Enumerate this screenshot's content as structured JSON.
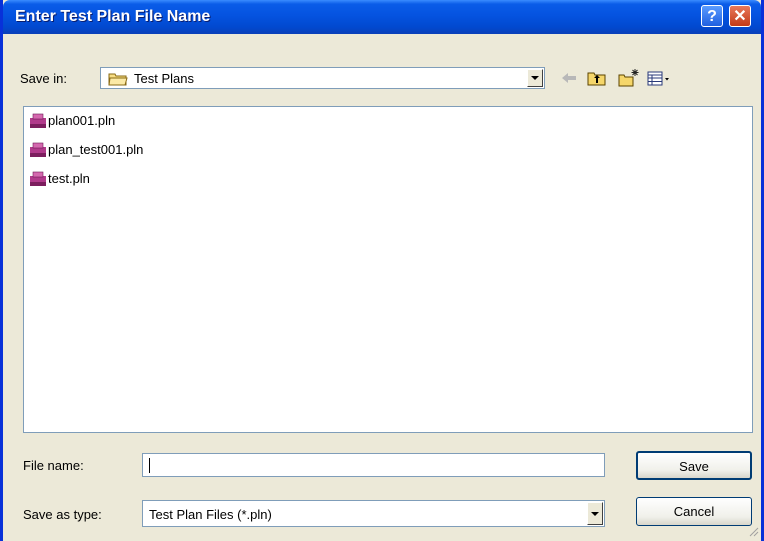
{
  "window": {
    "title": "Enter Test Plan File Name",
    "help_label": "?",
    "close_label": "✕"
  },
  "save_in": {
    "label": "Save in:",
    "value": "Test Plans"
  },
  "toolbar": {
    "icons": [
      "back-arrow-icon",
      "up-folder-icon",
      "new-folder-icon",
      "view-menu-icon"
    ]
  },
  "files": [
    {
      "name": "plan001.pln"
    },
    {
      "name": "plan_test001.pln"
    },
    {
      "name": "test.pln"
    }
  ],
  "file_name": {
    "label": "File name:",
    "value": ""
  },
  "save_type": {
    "label": "Save as type:",
    "value": "Test Plan Files (*.pln)"
  },
  "buttons": {
    "save": "Save",
    "cancel": "Cancel"
  },
  "colors": {
    "title_bar": "#0553e0",
    "face": "#ece9d8",
    "file_icon": "#b13a8b"
  }
}
